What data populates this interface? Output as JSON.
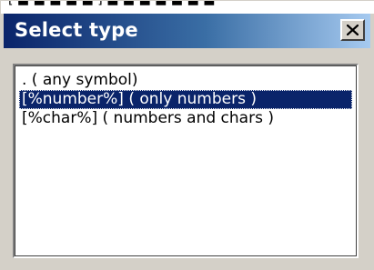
{
  "top_strip": {
    "text": "[ ■ ■ ■ ■ ■ ] ■ ■ ■ ■ ■ ■ ■"
  },
  "dialog": {
    "title": "Select type",
    "close_label": "✕"
  },
  "list": {
    "items": [
      {
        "label": ". ( any symbol)",
        "selected": false
      },
      {
        "label": "[%number%] ( only numbers )",
        "selected": true
      },
      {
        "label": "[%char%] ( numbers and chars )",
        "selected": false
      }
    ]
  },
  "colors": {
    "titlebar_start": "#0a246a",
    "titlebar_end": "#a6caf0",
    "selection": "#0a246a",
    "face": "#d4d0c8"
  }
}
